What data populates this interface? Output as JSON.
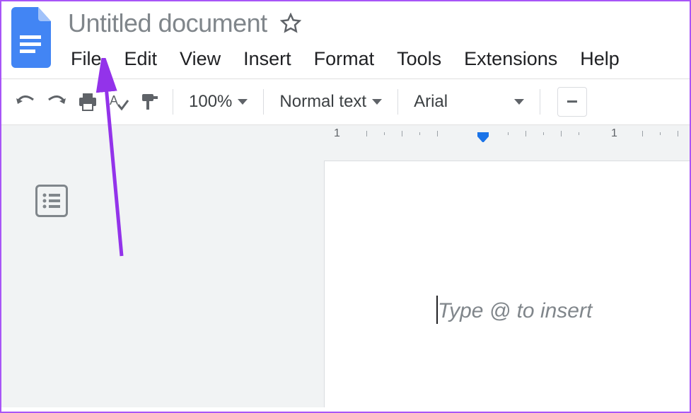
{
  "header": {
    "title": "Untitled document"
  },
  "menubar": {
    "items": [
      "File",
      "Edit",
      "View",
      "Insert",
      "Format",
      "Tools",
      "Extensions",
      "Help"
    ]
  },
  "toolbar": {
    "zoom": "100%",
    "style": "Normal text",
    "font": "Arial"
  },
  "ruler": {
    "label_left": "1",
    "label_right": "1"
  },
  "document": {
    "placeholder": "Type @ to insert"
  }
}
